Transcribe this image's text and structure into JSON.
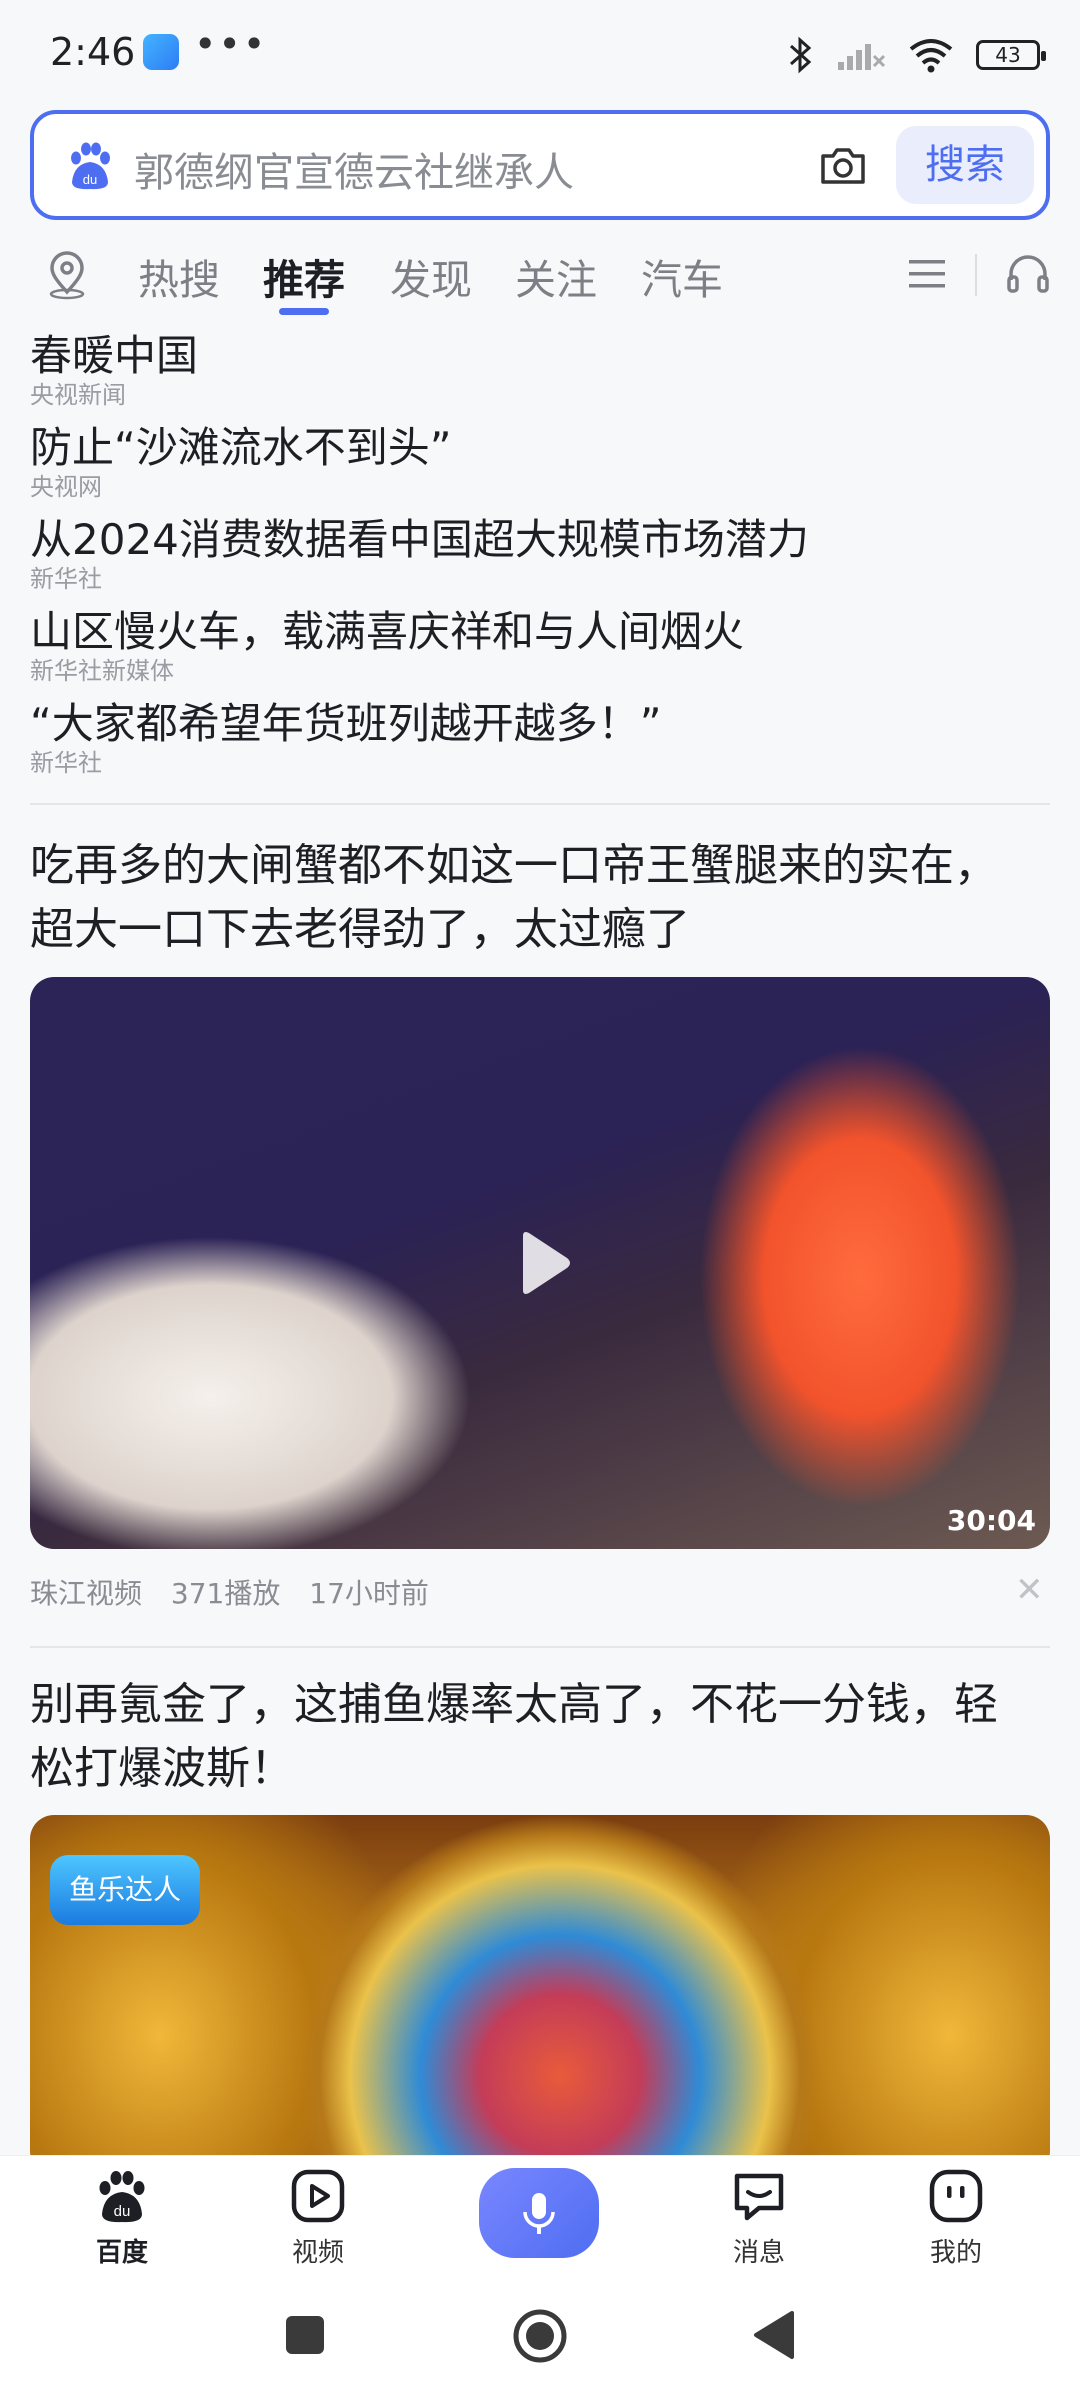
{
  "status_bar": {
    "time": "2:46",
    "dots": "•••",
    "battery": "43"
  },
  "search": {
    "placeholder": "郭德纲官宣德云社继承人",
    "button": "搜索"
  },
  "tabs": [
    "热搜",
    "推荐",
    "发现",
    "关注",
    "汽车"
  ],
  "active_tab": "推荐",
  "hot_list": [
    {
      "title": "春暖中国",
      "source": "央视新闻"
    },
    {
      "title": "防止“沙滩流水不到头”",
      "source": "央视网"
    },
    {
      "title": "从2024消费数据看中国超大规模市场潜力",
      "source": "新华社"
    },
    {
      "title": "山区慢火车，载满喜庆祥和与人间烟火",
      "source": "新华社新媒体"
    },
    {
      "title": "“大家都希望年货班列越开越多！”",
      "source": "新华社"
    }
  ],
  "feed": [
    {
      "title": "吃再多的大闸蟹都不如这一口帝王蟹腿来的实在，超大一口下去老得劲了，太过瘾了",
      "duration": "30:04",
      "source": "珠江视频",
      "plays": "371播放",
      "time": "17小时前"
    },
    {
      "title": "别再氪金了，这捕鱼爆率太高了，不花一分钱，轻松打爆波斯！",
      "logo": "鱼乐达人"
    }
  ],
  "bottom_nav": [
    {
      "label": "百度",
      "icon": "baidu-paw-icon"
    },
    {
      "label": "视频",
      "icon": "video-play-icon"
    },
    {
      "label": "",
      "icon": "mic-icon"
    },
    {
      "label": "消息",
      "icon": "chat-bubble-icon"
    },
    {
      "label": "我的",
      "icon": "profile-face-icon"
    }
  ],
  "colors": {
    "accent": "#4e6ef2",
    "text": "#1e1f24",
    "muted": "#9a9ca3"
  }
}
